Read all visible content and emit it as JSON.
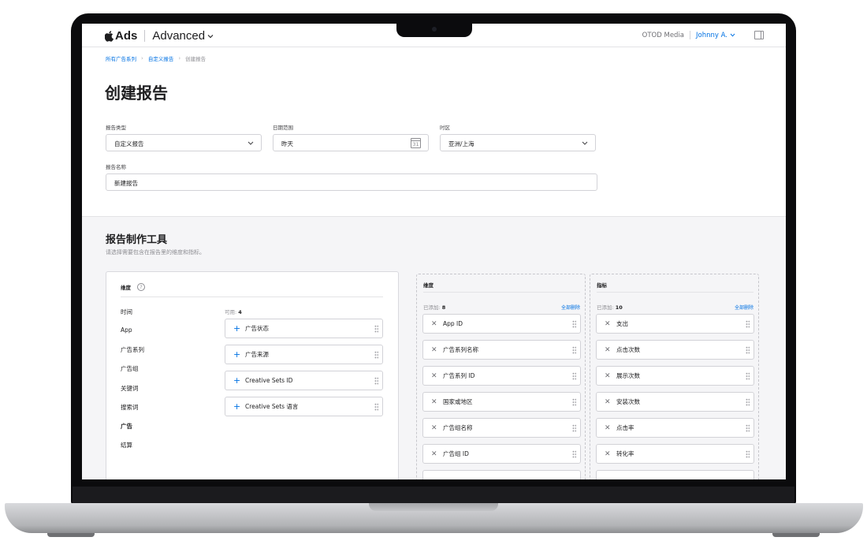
{
  "nav": {
    "brand": "Ads",
    "product": "Advanced",
    "org": "OTOD Media",
    "user": "Johnny A."
  },
  "breadcrumb": {
    "items": [
      "所有广告系列",
      "自定义报告"
    ],
    "current": "创建报告"
  },
  "page": {
    "title": "创建报告"
  },
  "form": {
    "report_type": {
      "label": "报告类型",
      "value": "自定义报告"
    },
    "date_range": {
      "label": "日期范围",
      "value": "昨天",
      "calendar_day": "31"
    },
    "timezone": {
      "label": "时区",
      "value": "亚洲/上海"
    },
    "report_name": {
      "label": "报告名称",
      "value": "新建报告"
    }
  },
  "builder": {
    "title": "报告制作工具",
    "subtitle": "请选择需要包含在报告里的维度和指标。",
    "dimensions_card": {
      "title": "维度",
      "help": "?",
      "categories": [
        "时间",
        "App",
        "广告系列",
        "广告组",
        "关键词",
        "搜索词",
        "广告",
        "结算"
      ],
      "active_category": "广告",
      "available_label": "可用:",
      "available_count": "4",
      "available_items": [
        "广告状态",
        "广告来源",
        "Creative Sets ID",
        "Creative Sets 语言"
      ]
    },
    "selected_dimensions": {
      "title": "维度",
      "added_label": "已添加:",
      "count": "8",
      "clear_all": "全部删除",
      "items": [
        "App ID",
        "广告系列名称",
        "广告系列 ID",
        "国家或地区",
        "广告组名称",
        "广告组 ID"
      ]
    },
    "selected_metrics": {
      "title": "指标",
      "added_label": "已添加:",
      "count": "10",
      "clear_all": "全部删除",
      "items": [
        "支出",
        "点击次数",
        "展示次数",
        "安装次数",
        "点击率",
        "转化率"
      ]
    }
  }
}
